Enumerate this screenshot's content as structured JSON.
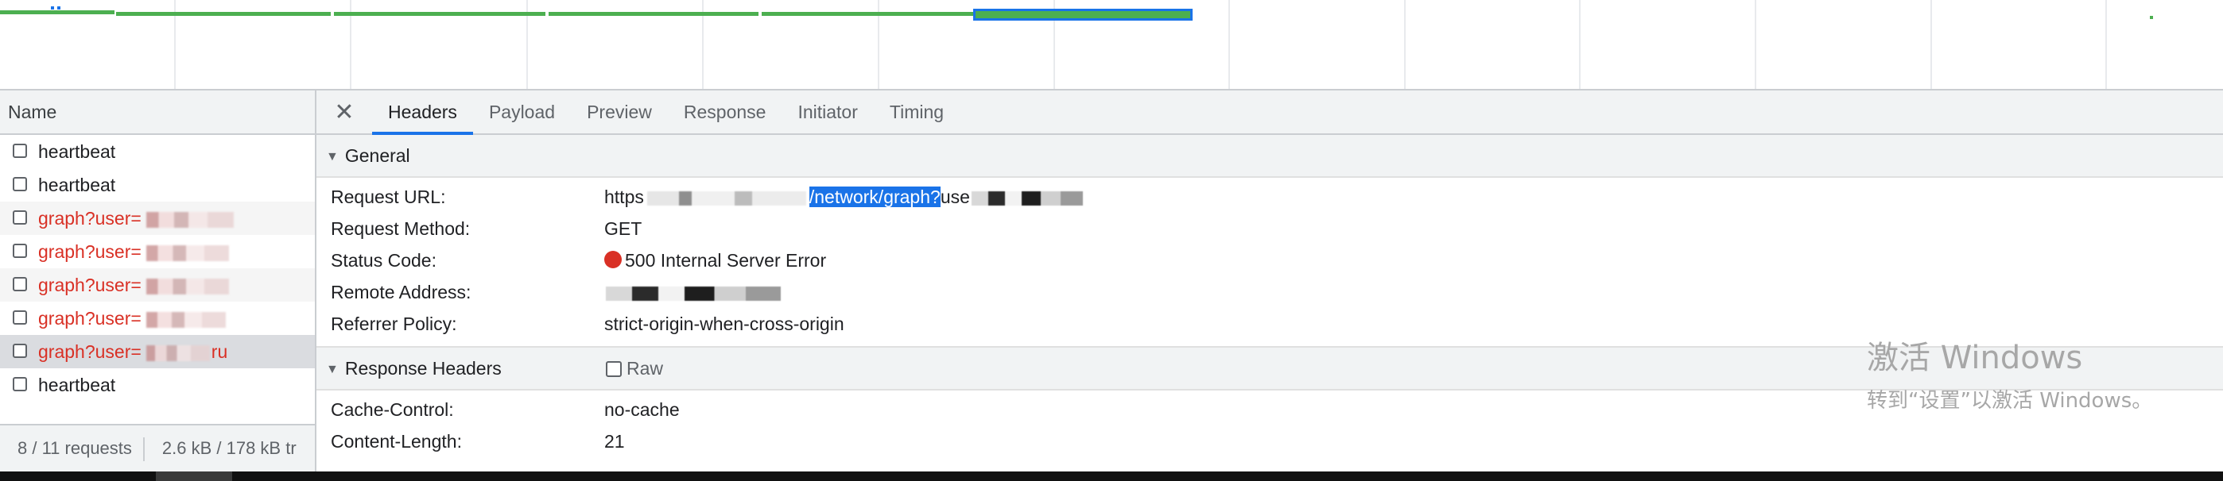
{
  "name_column_header": "Name",
  "requests": [
    {
      "label": "heartbeat",
      "status": "ok",
      "redacted": false
    },
    {
      "label": "heartbeat",
      "status": "ok",
      "redacted": false
    },
    {
      "label": "graph?user=",
      "status": "error",
      "redacted": true
    },
    {
      "label": "graph?user=",
      "status": "error",
      "redacted": true
    },
    {
      "label": "graph?user=",
      "status": "error",
      "redacted": true
    },
    {
      "label": "graph?user=",
      "status": "error",
      "redacted": true
    },
    {
      "label": "graph?user=",
      "status": "error",
      "redacted": true,
      "suffix": "ru",
      "selected": true
    },
    {
      "label": "heartbeat",
      "status": "ok",
      "redacted": false
    }
  ],
  "summary": {
    "requests": "8 / 11 requests",
    "transferred": "2.6 kB / 178 kB tr"
  },
  "tabs": [
    "Headers",
    "Payload",
    "Preview",
    "Response",
    "Initiator",
    "Timing"
  ],
  "active_tab": "Headers",
  "general": {
    "title": "General",
    "fields": {
      "request_url_label": "Request URL:",
      "request_url_prefix": "https",
      "request_url_highlight": "/network/graph?",
      "request_url_suffix": "use",
      "request_method_label": "Request Method:",
      "request_method": "GET",
      "status_code_label": "Status Code:",
      "status_code": "500 Internal Server Error",
      "remote_address_label": "Remote Address:",
      "referrer_policy_label": "Referrer Policy:",
      "referrer_policy": "strict-origin-when-cross-origin"
    }
  },
  "response_headers": {
    "title": "Response Headers",
    "raw_label": "Raw",
    "fields": {
      "cache_control_label": "Cache-Control:",
      "cache_control": "no-cache",
      "content_length_label": "Content-Length:",
      "content_length": "21"
    }
  },
  "watermark": {
    "line1": "激活 Windows",
    "line2": "转到“设置”以激活 Windows。"
  },
  "colors": {
    "error_text": "#d93025",
    "accent": "#1a73e8",
    "timeline_bar": "#4caf50"
  },
  "icons": {
    "close": "close-icon",
    "expand": "triangle-down-icon",
    "status": "red-dot-icon"
  }
}
